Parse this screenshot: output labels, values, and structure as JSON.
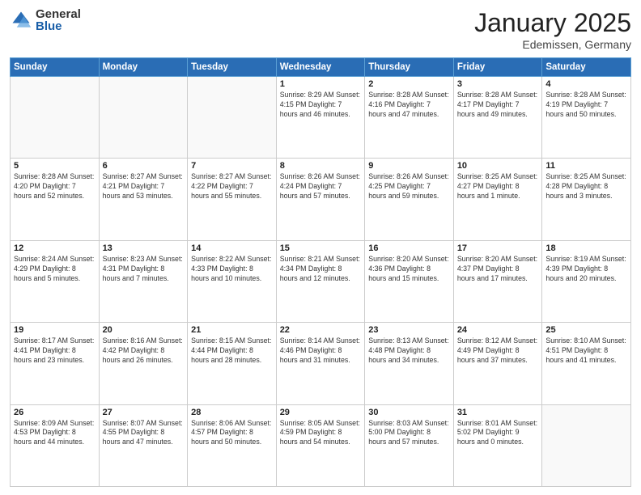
{
  "header": {
    "logo_general": "General",
    "logo_blue": "Blue",
    "month_title": "January 2025",
    "location": "Edemissen, Germany"
  },
  "days_of_week": [
    "Sunday",
    "Monday",
    "Tuesday",
    "Wednesday",
    "Thursday",
    "Friday",
    "Saturday"
  ],
  "weeks": [
    [
      {
        "day": "",
        "content": ""
      },
      {
        "day": "",
        "content": ""
      },
      {
        "day": "",
        "content": ""
      },
      {
        "day": "1",
        "content": "Sunrise: 8:29 AM\nSunset: 4:15 PM\nDaylight: 7 hours and 46 minutes."
      },
      {
        "day": "2",
        "content": "Sunrise: 8:28 AM\nSunset: 4:16 PM\nDaylight: 7 hours and 47 minutes."
      },
      {
        "day": "3",
        "content": "Sunrise: 8:28 AM\nSunset: 4:17 PM\nDaylight: 7 hours and 49 minutes."
      },
      {
        "day": "4",
        "content": "Sunrise: 8:28 AM\nSunset: 4:19 PM\nDaylight: 7 hours and 50 minutes."
      }
    ],
    [
      {
        "day": "5",
        "content": "Sunrise: 8:28 AM\nSunset: 4:20 PM\nDaylight: 7 hours and 52 minutes."
      },
      {
        "day": "6",
        "content": "Sunrise: 8:27 AM\nSunset: 4:21 PM\nDaylight: 7 hours and 53 minutes."
      },
      {
        "day": "7",
        "content": "Sunrise: 8:27 AM\nSunset: 4:22 PM\nDaylight: 7 hours and 55 minutes."
      },
      {
        "day": "8",
        "content": "Sunrise: 8:26 AM\nSunset: 4:24 PM\nDaylight: 7 hours and 57 minutes."
      },
      {
        "day": "9",
        "content": "Sunrise: 8:26 AM\nSunset: 4:25 PM\nDaylight: 7 hours and 59 minutes."
      },
      {
        "day": "10",
        "content": "Sunrise: 8:25 AM\nSunset: 4:27 PM\nDaylight: 8 hours and 1 minute."
      },
      {
        "day": "11",
        "content": "Sunrise: 8:25 AM\nSunset: 4:28 PM\nDaylight: 8 hours and 3 minutes."
      }
    ],
    [
      {
        "day": "12",
        "content": "Sunrise: 8:24 AM\nSunset: 4:29 PM\nDaylight: 8 hours and 5 minutes."
      },
      {
        "day": "13",
        "content": "Sunrise: 8:23 AM\nSunset: 4:31 PM\nDaylight: 8 hours and 7 minutes."
      },
      {
        "day": "14",
        "content": "Sunrise: 8:22 AM\nSunset: 4:33 PM\nDaylight: 8 hours and 10 minutes."
      },
      {
        "day": "15",
        "content": "Sunrise: 8:21 AM\nSunset: 4:34 PM\nDaylight: 8 hours and 12 minutes."
      },
      {
        "day": "16",
        "content": "Sunrise: 8:20 AM\nSunset: 4:36 PM\nDaylight: 8 hours and 15 minutes."
      },
      {
        "day": "17",
        "content": "Sunrise: 8:20 AM\nSunset: 4:37 PM\nDaylight: 8 hours and 17 minutes."
      },
      {
        "day": "18",
        "content": "Sunrise: 8:19 AM\nSunset: 4:39 PM\nDaylight: 8 hours and 20 minutes."
      }
    ],
    [
      {
        "day": "19",
        "content": "Sunrise: 8:17 AM\nSunset: 4:41 PM\nDaylight: 8 hours and 23 minutes."
      },
      {
        "day": "20",
        "content": "Sunrise: 8:16 AM\nSunset: 4:42 PM\nDaylight: 8 hours and 26 minutes."
      },
      {
        "day": "21",
        "content": "Sunrise: 8:15 AM\nSunset: 4:44 PM\nDaylight: 8 hours and 28 minutes."
      },
      {
        "day": "22",
        "content": "Sunrise: 8:14 AM\nSunset: 4:46 PM\nDaylight: 8 hours and 31 minutes."
      },
      {
        "day": "23",
        "content": "Sunrise: 8:13 AM\nSunset: 4:48 PM\nDaylight: 8 hours and 34 minutes."
      },
      {
        "day": "24",
        "content": "Sunrise: 8:12 AM\nSunset: 4:49 PM\nDaylight: 8 hours and 37 minutes."
      },
      {
        "day": "25",
        "content": "Sunrise: 8:10 AM\nSunset: 4:51 PM\nDaylight: 8 hours and 41 minutes."
      }
    ],
    [
      {
        "day": "26",
        "content": "Sunrise: 8:09 AM\nSunset: 4:53 PM\nDaylight: 8 hours and 44 minutes."
      },
      {
        "day": "27",
        "content": "Sunrise: 8:07 AM\nSunset: 4:55 PM\nDaylight: 8 hours and 47 minutes."
      },
      {
        "day": "28",
        "content": "Sunrise: 8:06 AM\nSunset: 4:57 PM\nDaylight: 8 hours and 50 minutes."
      },
      {
        "day": "29",
        "content": "Sunrise: 8:05 AM\nSunset: 4:59 PM\nDaylight: 8 hours and 54 minutes."
      },
      {
        "day": "30",
        "content": "Sunrise: 8:03 AM\nSunset: 5:00 PM\nDaylight: 8 hours and 57 minutes."
      },
      {
        "day": "31",
        "content": "Sunrise: 8:01 AM\nSunset: 5:02 PM\nDaylight: 9 hours and 0 minutes."
      },
      {
        "day": "",
        "content": ""
      }
    ]
  ]
}
